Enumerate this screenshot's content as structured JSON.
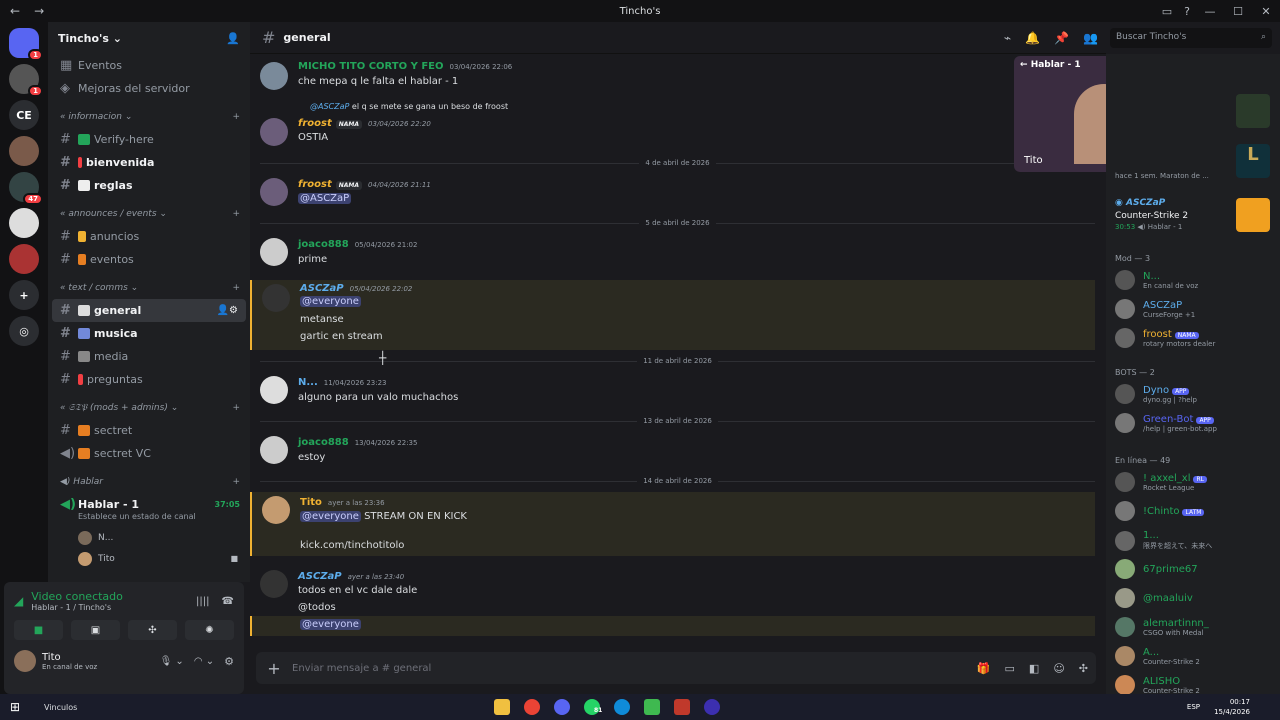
{
  "window": {
    "title": "Tincho's"
  },
  "servers": [
    {
      "label": "",
      "badge": "1",
      "color": "#5865f2"
    },
    {
      "label": "",
      "badge": "1",
      "color": "#555"
    },
    {
      "label": "CE",
      "badge": "",
      "color": "#2b2d31"
    },
    {
      "label": "",
      "badge": "",
      "color": "#7a5a4a"
    },
    {
      "label": "",
      "badge": "47",
      "color": "#344"
    },
    {
      "label": "",
      "badge": "",
      "color": "#ddd"
    },
    {
      "label": "",
      "badge": "",
      "color": "#a33"
    }
  ],
  "guild": {
    "name": "Tincho's"
  },
  "sidebar_top": {
    "events": "Eventos",
    "boosts": "Mejoras del servidor"
  },
  "categories": {
    "info": "informacion",
    "announces": "announces / events",
    "text": "text / comms",
    "staff": "𝔖𝔗𝔓 (mods + admins)",
    "voice": "Hablar"
  },
  "channels": {
    "verify": "Verify-here",
    "bienvenida": "bienvenida",
    "reglas": "reglas",
    "anuncios": "anuncios",
    "eventos": "eventos",
    "general": "general",
    "musica": "musica",
    "media": "media",
    "preguntas": "preguntas",
    "secret": "sectret",
    "secret_vc": "sectret VC",
    "hablar": "Hablar - 1",
    "hablar_time": "37:05",
    "hablar_status": "Establece un estado de canal"
  },
  "voice_users": [
    "N...",
    "Tito"
  ],
  "voice_panel": {
    "status": "Video conectado",
    "channel": "Hablar - 1 / Tincho's"
  },
  "user": {
    "name": "Tito",
    "status": "En canal de voz"
  },
  "header": {
    "channel": "general",
    "search": "Buscar Tincho's"
  },
  "messages": {
    "m1": {
      "author": "MICHO TITO CORTO Y FEO",
      "time": "03/04/2026 22:06",
      "text": "che mepa q le falta el hablar - 1"
    },
    "m2_reply": {
      "author": "@ASCZaP",
      "text": "el q se mete se gana un beso de froost"
    },
    "m2": {
      "author": "froost",
      "tag": "NAMA",
      "time": "03/04/2026 22:20",
      "text": "OSTIA"
    },
    "d1": "4 de abril de 2026",
    "m3": {
      "author": "froost",
      "tag": "NAMA",
      "time": "04/04/2026 21:11",
      "text": "@ASCZaP"
    },
    "d2": "5 de abril de 2026",
    "m4": {
      "author": "joaco888",
      "time": "05/04/2026 21:02",
      "text": "prime"
    },
    "m5": {
      "author": "ASCZaP",
      "time": "05/04/2026 22:02",
      "mention": "@everyone",
      "line2": "metanse",
      "line3": "gartic en stream"
    },
    "d3": "11 de abril de 2026",
    "m6": {
      "author": "N...",
      "time": "11/04/2026 23:23",
      "text": "alguno para un valo muchachos"
    },
    "d4": "13 de abril de 2026",
    "m7": {
      "author": "joaco888",
      "time": "13/04/2026 22:35",
      "text": "estoy"
    },
    "d5": "14 de abril de 2026",
    "m8": {
      "author": "Tito",
      "time": "ayer a las 23:36",
      "mention": "@everyone",
      "text": "STREAM ON EN KICK",
      "link": "kick.com/tinchotitolo"
    },
    "m9": {
      "author": "ASCZaP",
      "time": "ayer a las 23:40",
      "text": "todos en el vc dale dale",
      "line2": "@todos",
      "mention": "@everyone"
    }
  },
  "input": {
    "placeholder": "Enviar mensaje a #",
    "channel": "general"
  },
  "stream": {
    "title": "Hablar - 1",
    "user": "Tito"
  },
  "activity": [
    {
      "line1": "hace 1 sem.",
      "line2": "Maraton de ..."
    },
    {
      "name": "ASCZaP",
      "game": "Counter-Strike 2",
      "time": "30:53",
      "vc": "Hablar - 1"
    }
  ],
  "members": {
    "mod_header": "Mod — 3",
    "mods": [
      {
        "name": "N...",
        "status": "En canal de voz",
        "color": "#23a55a"
      },
      {
        "name": "ASCZaP",
        "status": "CurseForge +1",
        "color": "#5dadec"
      },
      {
        "name": "froost",
        "tag": "NAMA",
        "status": "rotary motors dealer",
        "color": "#f0b232"
      }
    ],
    "bots_header": "BOTS — 2",
    "bots": [
      {
        "name": "Dyno",
        "tag": "APP",
        "status": "dyno.gg | ?help",
        "color": "#5dadec"
      },
      {
        "name": "Green-Bot",
        "tag": "APP",
        "status": "/help | green-bot.app",
        "color": "#5865f2"
      }
    ],
    "online_header": "En línea — 49",
    "online": [
      {
        "name": "! axxel_xl",
        "tag": "RL",
        "status": "Rocket League"
      },
      {
        "name": "!Chinto",
        "tag": "LATM",
        "status": ""
      },
      {
        "name": "1...",
        "status": "限界を超えて、未来へ"
      },
      {
        "name": "67prime67",
        "status": ""
      },
      {
        "name": "@maaluiv",
        "status": ""
      },
      {
        "name": "alemartinnn_",
        "status": "CSGO with Medal"
      },
      {
        "name": "A...",
        "status": "Counter-Strike 2"
      },
      {
        "name": "ALISHO",
        "status": "Counter-Strike 2"
      }
    ]
  },
  "taskbar": {
    "search": "Vinculos",
    "lang": "ESP",
    "time": "00:17",
    "date": "15/4/2026",
    "badge": "81"
  }
}
